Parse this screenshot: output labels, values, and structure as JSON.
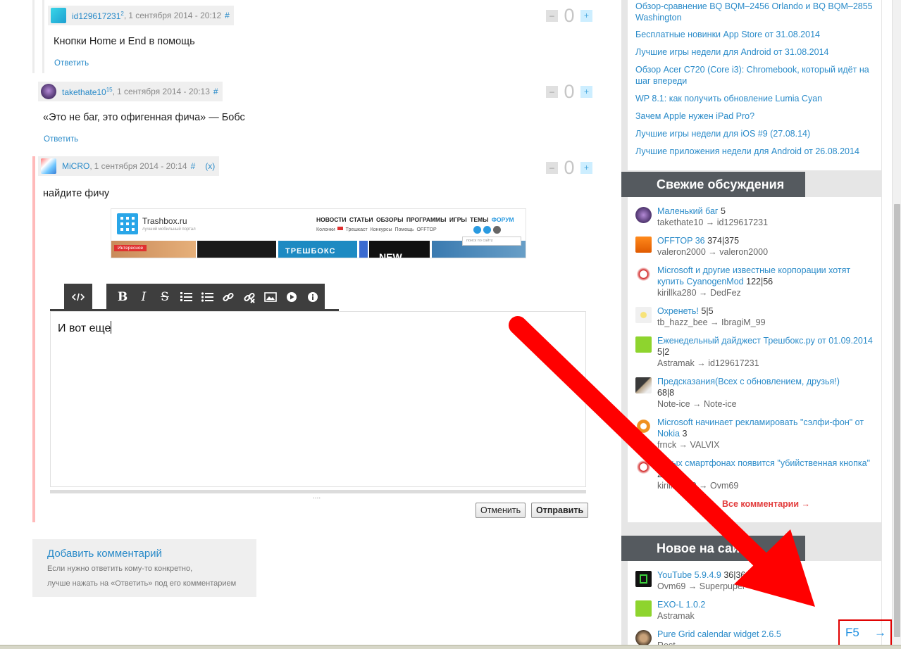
{
  "comments": [
    {
      "author": "id129617231",
      "rating": "2",
      "date": "1 сентября 2014 - 20:12",
      "anchor": "#",
      "text": "Кнопки Home и End в помощь",
      "reply": "Ответить",
      "score": "0"
    },
    {
      "author": "takethate10",
      "rating": "15",
      "date": "1 сентября 2014 - 20:13",
      "anchor": "#",
      "text": "«Это не баг, это офигенная фича» — Бобс",
      "reply": "Ответить",
      "score": "0"
    },
    {
      "author": "MiCRO",
      "date": "1 сентября 2014 - 20:14",
      "anchor": "#",
      "extra": "(x)",
      "text": "найдите фичу",
      "score": "0"
    }
  ],
  "vote": {
    "minus": "–",
    "plus": "+"
  },
  "embed": {
    "site": "Trashbox.ru",
    "tagline": "лучший мобильный портал",
    "nav": [
      "НОВОСТИ",
      "СТАТЬИ",
      "ОБЗОРЫ",
      "ПРОГРАММЫ",
      "ИГРЫ",
      "ТЕМЫ"
    ],
    "nav_forum": "ФОРУМ",
    "subnav": [
      "Колонки",
      "Трешкаст",
      "Конкурсы",
      "Помощь",
      "OFFTOP"
    ],
    "search_placeholder": "поиск по сайту",
    "tag": "Интересное",
    "tile_text": "ТРЕШБОКС",
    "tile_new": "NEW"
  },
  "editor": {
    "text": "И вот еще",
    "cancel": "Отменить",
    "submit": "Отправить",
    "grip": "....",
    "tools": [
      "html",
      "bold",
      "italic",
      "strike",
      "ordered-list",
      "unordered-list",
      "link",
      "unlink",
      "image",
      "video",
      "info"
    ]
  },
  "add_comment": {
    "title": "Добавить комментарий",
    "desc_line1": "Если нужно ответить кому-то конкретно,",
    "desc_line2": "лучше нажать на «Ответить» под его комментарием"
  },
  "sidebar": {
    "news": [
      "Обзор-сравнение BQ BQM–2456 Orlando и BQ BQM–2855 Washington",
      "Бесплатные новинки App Store от 31.08.2014",
      "Лучшие игры недели для Android от 31.08.2014",
      "Обзор Acer C720 (Core i3): Chromebook, который идёт на шаг впереди",
      "WP 8.1: как получить обновление Lumia Cyan",
      "Зачем Apple нужен iPad Pro?",
      "Лучшие игры недели для iOS #9 (27.08.14)",
      "Лучшие приложения недели для Android от 26.08.2014"
    ],
    "discussions_title": "Свежие обсуждения",
    "discussions": [
      {
        "title": "Маленький баг",
        "count": "5",
        "meta": "takethate10 → id129617231"
      },
      {
        "title": "OFFTOP 36",
        "count": "374|375",
        "meta": "valeron2000 → valeron2000"
      },
      {
        "title": "Microsoft и другие известные корпорации хотят купить CyanogenMod",
        "count": "122|56",
        "meta": "kirillka280 → DedFez"
      },
      {
        "title": "Охренеть!",
        "count": "5|5",
        "meta": "tb_hazz_bee → IbragiM_99"
      },
      {
        "title": "Еженедельный дайджест Трешбокс.ру от 01.09.2014",
        "count": "5|2",
        "meta": "Astramak → id129617231"
      },
      {
        "title": "Предсказания(Всех с обновлением, друзья!)",
        "count": "68|8",
        "meta": "Note-ice → Note-ice"
      },
      {
        "title": "Microsoft начинает рекламировать \"сэлфи-фон\" от Nokia",
        "count": "3",
        "meta": "frnck → VALVIX"
      },
      {
        "title": "новых смартфонах появится \"убийственная кнопка\"",
        "count": "25",
        "meta": "kirillka280 → Ovm69"
      }
    ],
    "all_comments": "Все комментарии →",
    "new_title": "Новое на сайте",
    "new_items": [
      {
        "title": "YouTube 5.9.4.9",
        "count": "36|36",
        "meta": "Ovm69 → Superpuper"
      },
      {
        "title": "EXO-L 1.0.2",
        "count": "",
        "meta": "Astramak"
      },
      {
        "title": "Pure Grid calendar widget 2.6.5",
        "count": "",
        "meta": "Rost"
      }
    ]
  },
  "f5": {
    "label": "F5",
    "arrow": "→"
  },
  "colors": {
    "link": "#2a8bc9",
    "accent_red": "#e00000",
    "section_header": "#555a5f",
    "highlight": "#ffbaba"
  }
}
